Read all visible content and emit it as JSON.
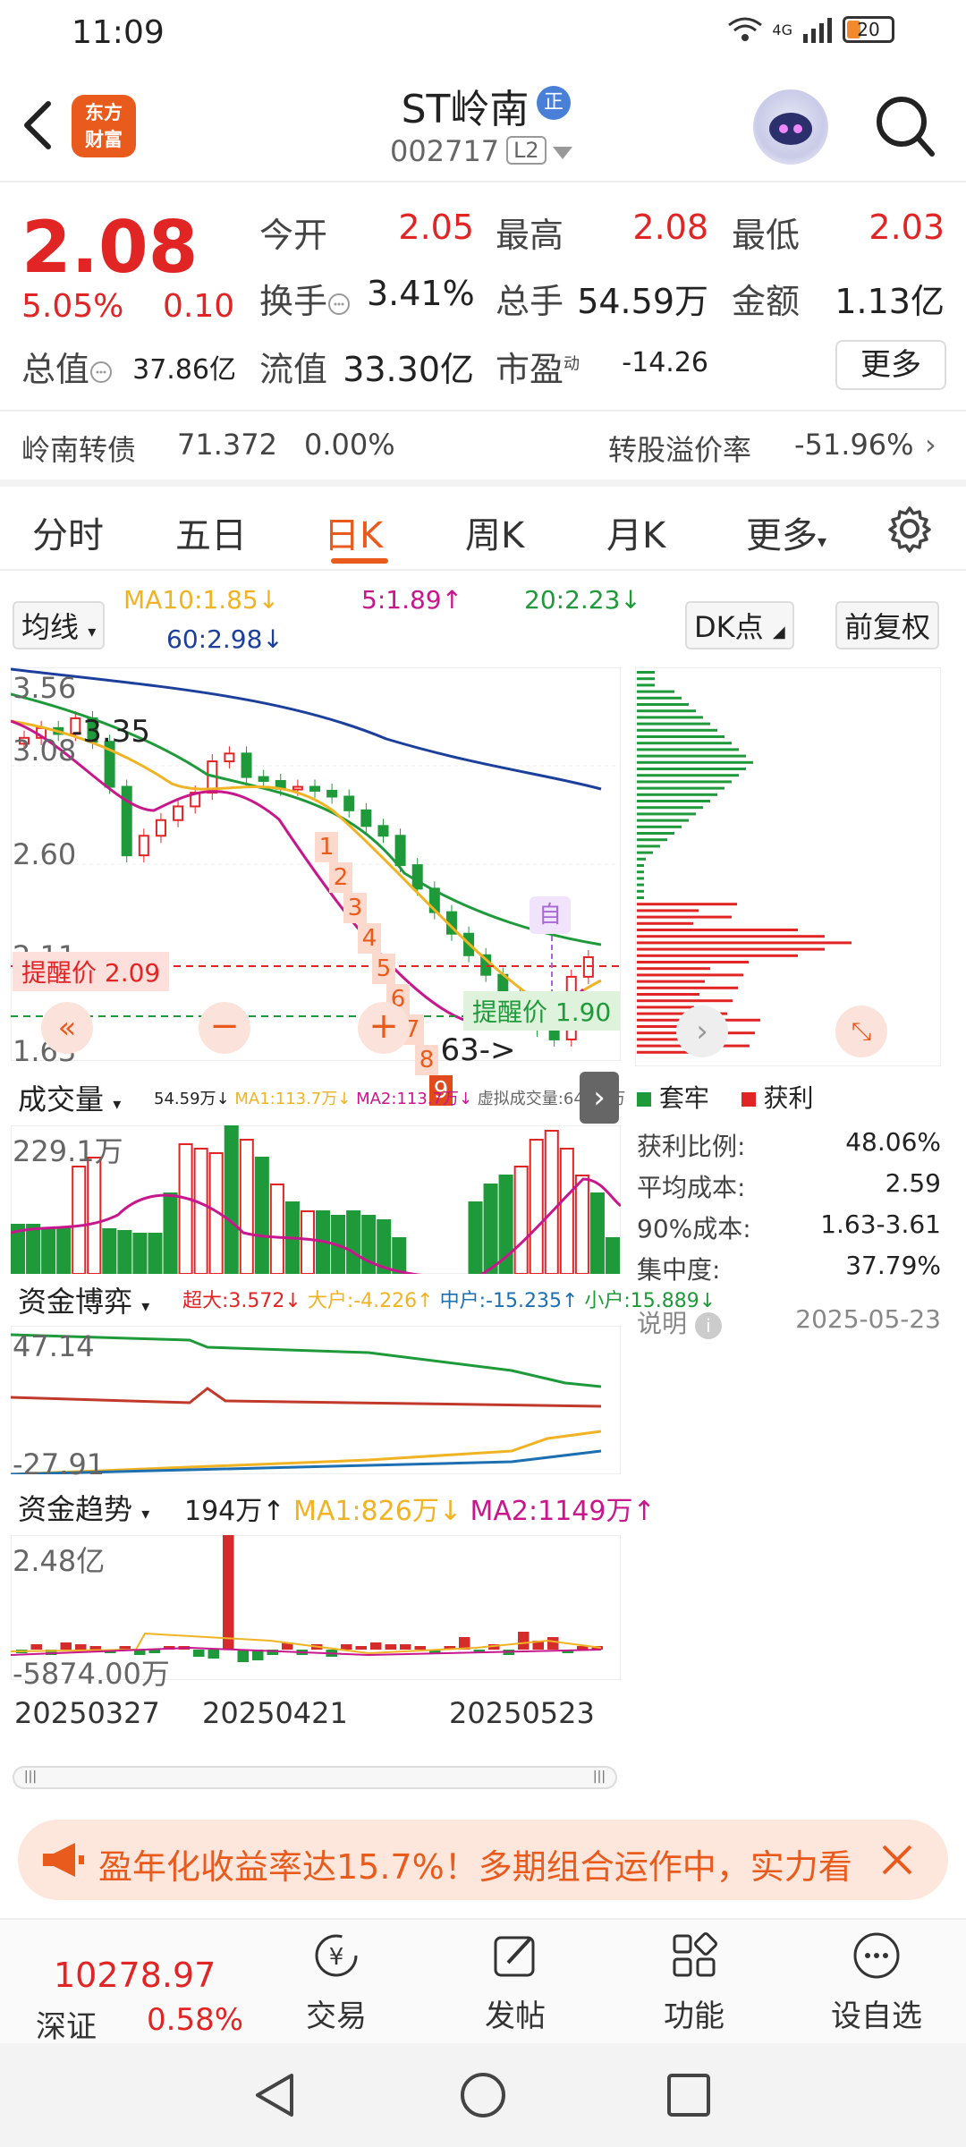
{
  "status": {
    "time": "11:09",
    "signal": "4G",
    "battery": "20"
  },
  "header": {
    "logo": "东方\n财富",
    "stock_name": "ST岭南",
    "badge": "正",
    "code": "002717",
    "level": "L2"
  },
  "quote": {
    "price": "2.08",
    "change_pct": "5.05%",
    "change": "0.10",
    "labels": {
      "open": "今开",
      "high": "最高",
      "low": "最低",
      "turnover": "换手",
      "volume": "总手",
      "amount": "金额",
      "mcap": "总值",
      "float": "流值",
      "pe": "市盈"
    },
    "open": "2.05",
    "high": "2.08",
    "low": "2.03",
    "turnover": "3.41%",
    "volume": "54.59万",
    "amount": "1.13亿",
    "mcap": "37.86亿",
    "float": "33.30亿",
    "pe_sup": "动",
    "pe": "-14.26",
    "more": "更多"
  },
  "bond": {
    "label": "岭南转债",
    "price": "71.372",
    "pct": "0.00%",
    "premium_label": "转股溢价率",
    "premium": "-51.96%"
  },
  "tabs": [
    "分时",
    "五日",
    "日K",
    "周K",
    "月K",
    "更多"
  ],
  "active_tab": 2,
  "kline": {
    "indicator_select": "均线",
    "ma10": "MA10:1.85↓",
    "ma5": "5:1.89↑",
    "ma20": "20:2.23↓",
    "ma60": "60:2.98↓",
    "dk": "DK点",
    "adjust": "前复权",
    "y_labels": [
      "3.56",
      "3.08",
      "2.60",
      "2.11",
      "1.63"
    ],
    "annot_high": "-3.35",
    "annot_low": "1.63->",
    "remind1": "提醒价 2.09",
    "remind2": "提醒价 1.90",
    "self_mark": "自",
    "seq_labels": [
      "1",
      "2",
      "3",
      "4",
      "5",
      "6",
      "7",
      "8",
      "9"
    ],
    "closes": [
      3.2,
      3.25,
      3.22,
      3.3,
      3.18,
      2.95,
      2.6,
      2.7,
      2.78,
      2.85,
      2.92,
      3.08,
      3.12,
      3.0,
      2.98,
      2.94,
      2.95,
      2.93,
      2.9,
      2.83,
      2.75,
      2.7,
      2.55,
      2.43,
      2.31,
      2.2,
      2.09,
      1.99,
      1.89,
      1.8,
      1.71,
      1.66,
      1.98,
      2.08
    ]
  },
  "volume": {
    "select": "成交量",
    "summary": "54.59万↓",
    "ma1": "MA1:113.7万↓",
    "ma2": "MA2:113.7万↓",
    "virtual": "虚拟成交量:64.64万",
    "max_label": "229.1万"
  },
  "fund_game": {
    "select": "资金博弈",
    "super": "超大:3.572↓",
    "large": "大户:-4.226↑",
    "mid": "中户:-15.235↑",
    "small": "小户:15.889↓",
    "top": "47.14",
    "bottom": "-27.91"
  },
  "fund_trend": {
    "select": "资金趋势",
    "value": "194万↑",
    "ma1": "MA1:826万↓",
    "ma2": "MA2:1149万↑",
    "top": "2.48亿",
    "bottom": "-5874.00万"
  },
  "dates": [
    "20250327",
    "20250421",
    "20250523"
  ],
  "chip": {
    "legend_trapped": "套牢",
    "legend_profit": "获利",
    "rows": [
      {
        "label": "获利比例:",
        "value": "48.06%"
      },
      {
        "label": "平均成本:",
        "value": "2.59"
      },
      {
        "label": "90%成本:",
        "value": "1.63-3.61"
      },
      {
        "label": "集中度:",
        "value": "37.79%"
      }
    ],
    "note": "说明",
    "date": "2025-05-23"
  },
  "banner": {
    "text": "盈年化收益率达15.7%！多期组合运作中，实力看"
  },
  "bottom_nav": {
    "index_value": "10278.97",
    "index_name": "深证",
    "index_pct": "0.58%",
    "items": [
      "交易",
      "发帖",
      "功能",
      "设自选"
    ]
  },
  "colors": {
    "up": "#e12424",
    "down": "#1f9a3a",
    "accent": "#e85b1d",
    "ma5": "#c8168c",
    "ma10": "#f0b323",
    "ma20": "#1f9a3a",
    "ma60": "#1c3f9c"
  }
}
